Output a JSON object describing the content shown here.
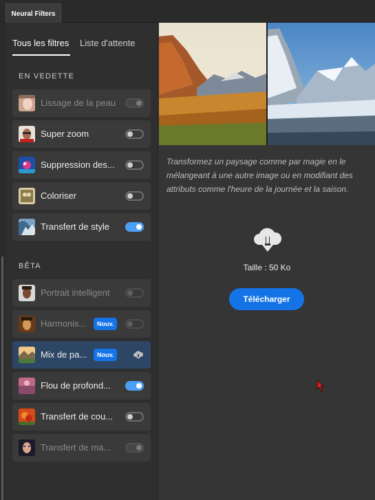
{
  "panel": {
    "tab_title": "Neural Filters"
  },
  "sub_tabs": {
    "all_filters": "Tous les filtres",
    "waitlist": "Liste d'attente"
  },
  "sections": {
    "featured": {
      "label": "EN VEDETTE",
      "items": [
        {
          "label": "Lissage de la peau",
          "toggle": "disabled",
          "thumb_icon": "face-portrait-icon"
        },
        {
          "label": "Super zoom",
          "toggle": "off",
          "thumb_icon": "man-portrait-icon"
        },
        {
          "label": "Suppression des...",
          "toggle": "off",
          "thumb_icon": "artifact-removal-icon"
        },
        {
          "label": "Coloriser",
          "toggle": "off",
          "thumb_icon": "vintage-photo-icon"
        },
        {
          "label": "Transfert de style",
          "toggle": "on",
          "thumb_icon": "painting-style-icon"
        }
      ]
    },
    "beta": {
      "label": "BÊTA",
      "items": [
        {
          "label": "Portrait intelligent",
          "toggle": "disabled-off",
          "thumb_icon": "portrait-icon"
        },
        {
          "label": "Harmonis...",
          "badge": "Nouv.",
          "toggle": "disabled-off",
          "thumb_icon": "harmonization-icon"
        },
        {
          "label": "Mix de pa...",
          "badge": "Nouv.",
          "action_icon": "cloud-download-icon",
          "selected": true,
          "thumb_icon": "landscape-icon"
        },
        {
          "label": "Flou de profond...",
          "toggle": "on",
          "thumb_icon": "depth-blur-icon"
        },
        {
          "label": "Transfert de cou...",
          "toggle": "off",
          "thumb_icon": "color-transfer-icon"
        },
        {
          "label": "Transfert de ma...",
          "toggle": "disabled",
          "thumb_icon": "makeup-transfer-icon"
        }
      ]
    }
  },
  "detail": {
    "description": "Transformez un paysage comme par magie en le mélangeant à une autre image ou en modifiant des attributs comme l'heure de la journée et la saison.",
    "size_text": "Taille : 50 Ko",
    "download_label": "Télécharger",
    "download_icon": "cloud-download-icon"
  },
  "colors": {
    "accent": "#1473e6",
    "toggle_on": "#4c9ff6",
    "selected_row": "#2e4665",
    "panel_bg": "#2f2f2f",
    "main_bg": "#353535"
  }
}
